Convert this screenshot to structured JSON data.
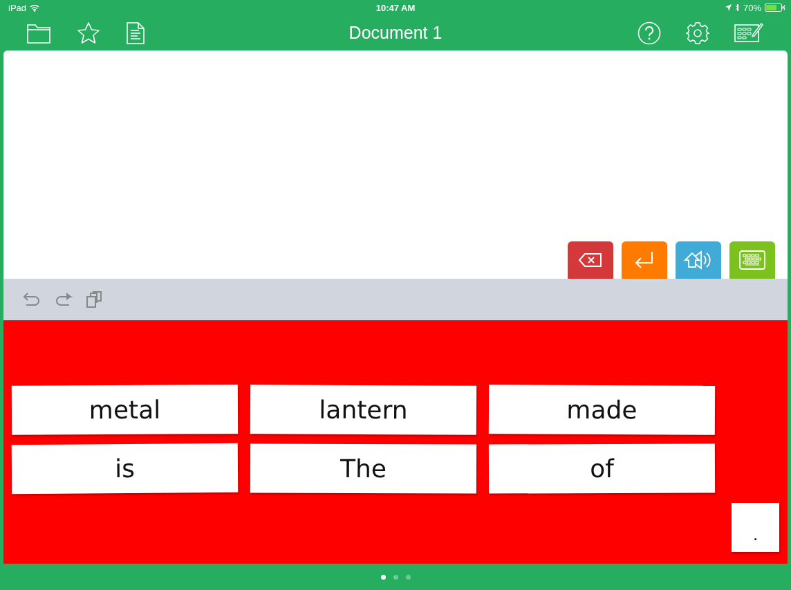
{
  "status_bar": {
    "device": "iPad",
    "time": "10:47 AM",
    "battery": "70%"
  },
  "toolbar": {
    "title": "Document 1"
  },
  "action_buttons": [
    {
      "kind": "delete",
      "color": "#d3393b"
    },
    {
      "kind": "enter",
      "color": "#ff7b00"
    },
    {
      "kind": "speak",
      "color": "#3fabd6"
    },
    {
      "kind": "keyboard",
      "color": "#7dc11e"
    }
  ],
  "edit_bar": [
    {
      "kind": "undo"
    },
    {
      "kind": "redo"
    },
    {
      "kind": "copy"
    }
  ],
  "word_tiles": [
    {
      "text": "metal"
    },
    {
      "text": "lantern"
    },
    {
      "text": "made"
    },
    {
      "text": "is"
    },
    {
      "text": "The"
    },
    {
      "text": "of"
    }
  ],
  "punctuation_tiles": [
    {
      "text": "."
    }
  ],
  "page_dots": [
    {
      "selected": true
    },
    {
      "selected": false
    },
    {
      "selected": false
    }
  ]
}
